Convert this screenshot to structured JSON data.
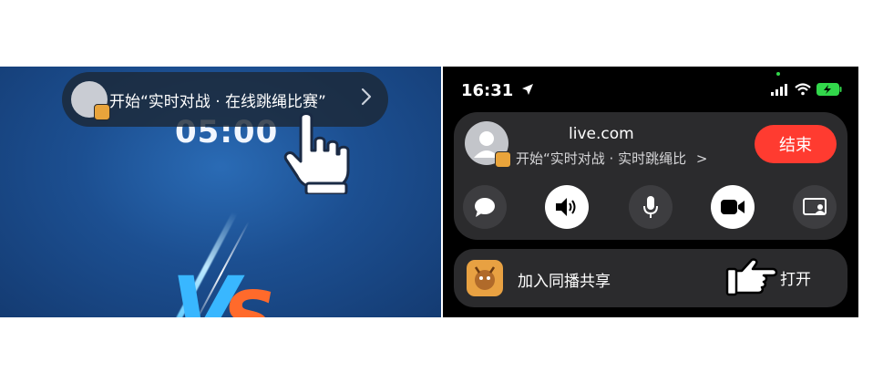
{
  "left_panel": {
    "banner_text": "开始“实时对战 · 在线跳绳比赛”",
    "timer": "05:00",
    "vs_v": "V",
    "vs_s": "S"
  },
  "right_panel": {
    "status_time": "16:31",
    "call_title": "live.com",
    "call_subtitle": "开始“实时对战 · 实时跳绳比",
    "chevron": ">",
    "end_button_label": "结束",
    "share_label": "加入同播共享",
    "open_button_label": "打开"
  },
  "colors": {
    "end_button": "#ff3b30",
    "share_app_icon": "#e8a142",
    "battery": "#32d74b"
  },
  "icons": {
    "banner": [
      "avatar",
      "chevron-right-icon",
      "pointing-hand-icon"
    ],
    "status_bar": [
      "location-arrow-icon",
      "cellular-signal-icon",
      "wifi-icon",
      "battery-charging-icon"
    ],
    "call_controls": [
      "message-icon",
      "speaker-icon",
      "microphone-icon",
      "video-camera-icon",
      "screen-share-icon"
    ],
    "share_row": [
      "app-icon",
      "pointing-hand-icon"
    ]
  }
}
